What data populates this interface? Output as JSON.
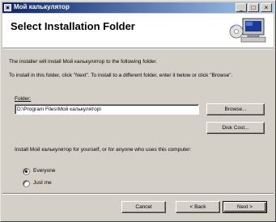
{
  "window": {
    "title": "Мой калькулятор",
    "minimize_glyph": "_",
    "maximize_glyph": "□",
    "close_glyph": "×"
  },
  "header": {
    "title": "Select Installation Folder"
  },
  "body": {
    "line1": "The installer will install Мой калькулятор to the following folder.",
    "line2": "To install in this folder, click \"Next\". To install to a different folder, enter it below or click \"Browse\".",
    "folder_label": "Folder:",
    "folder_value": "D:\\Program Files\\Мой калькулятор\\",
    "browse_label": "Browse...",
    "disk_cost_label": "Disk Cost...",
    "install_for_text": "Install Мой калькулятор for yourself, or for anyone who uses this computer:",
    "options": [
      {
        "label": "Everyone",
        "selected": true
      },
      {
        "label": "Just me",
        "selected": false
      }
    ]
  },
  "footer": {
    "cancel_label": "Cancel",
    "back_label": "< Back",
    "next_label": "Next >"
  }
}
